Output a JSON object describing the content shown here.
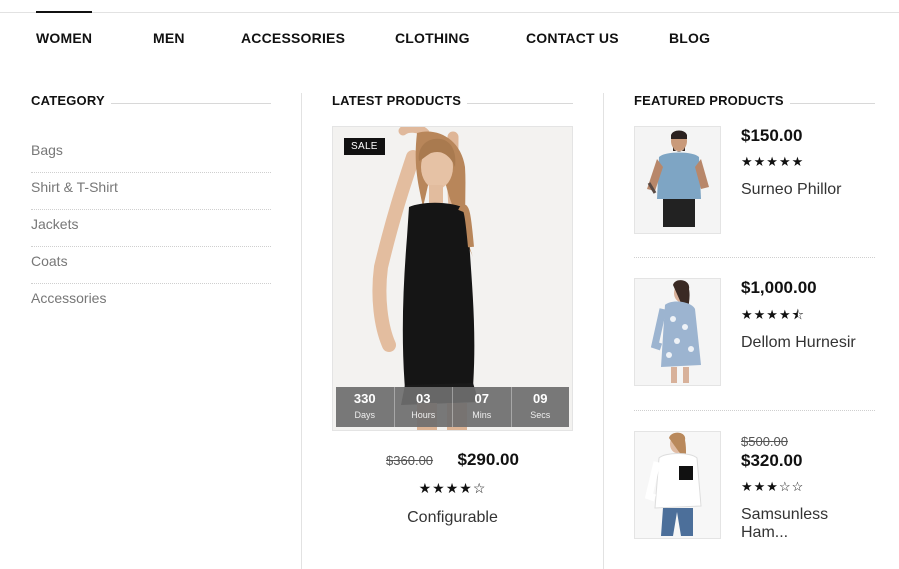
{
  "nav": {
    "items": [
      {
        "label": "WOMEN",
        "active": true
      },
      {
        "label": "MEN",
        "active": false
      },
      {
        "label": "ACCESSORIES",
        "active": false
      },
      {
        "label": "CLOTHING",
        "active": false
      },
      {
        "label": "CONTACT US",
        "active": false
      },
      {
        "label": "BLOG",
        "active": false
      }
    ]
  },
  "category": {
    "title": "CATEGORY",
    "items": [
      "Bags",
      "Shirt & T-Shirt",
      "Jackets",
      "Coats",
      "Accessories"
    ]
  },
  "latest": {
    "title": "LATEST PRODUCTS",
    "badge": "SALE",
    "countdown": [
      {
        "value": "330",
        "label": "Days"
      },
      {
        "value": "03",
        "label": "Hours"
      },
      {
        "value": "07",
        "label": "Mins"
      },
      {
        "value": "09",
        "label": "Secs"
      }
    ],
    "old_price": "$360.00",
    "price": "$290.00",
    "rating_stars": "★★★★☆",
    "rating": 4,
    "name": "Configurable"
  },
  "featured": {
    "title": "FEATURED PRODUCTS",
    "items": [
      {
        "price": "$150.00",
        "old_price": "",
        "rating_stars": "★★★★★",
        "rating": 5,
        "name": "Surneo Phillor"
      },
      {
        "price": "$1,000.00",
        "old_price": "",
        "rating_stars": "★★★★⯪",
        "rating": 4.5,
        "name": "Dellom Hurnesir"
      },
      {
        "price": "$320.00",
        "old_price": "$500.00",
        "rating_stars": "★★★☆☆",
        "rating": 3,
        "name": "Samsunless Ham..."
      }
    ]
  },
  "colors": {
    "text": "#111111",
    "muted": "#777777",
    "badge_bg": "#111111",
    "countdown_bg": "#6e6e6e"
  }
}
